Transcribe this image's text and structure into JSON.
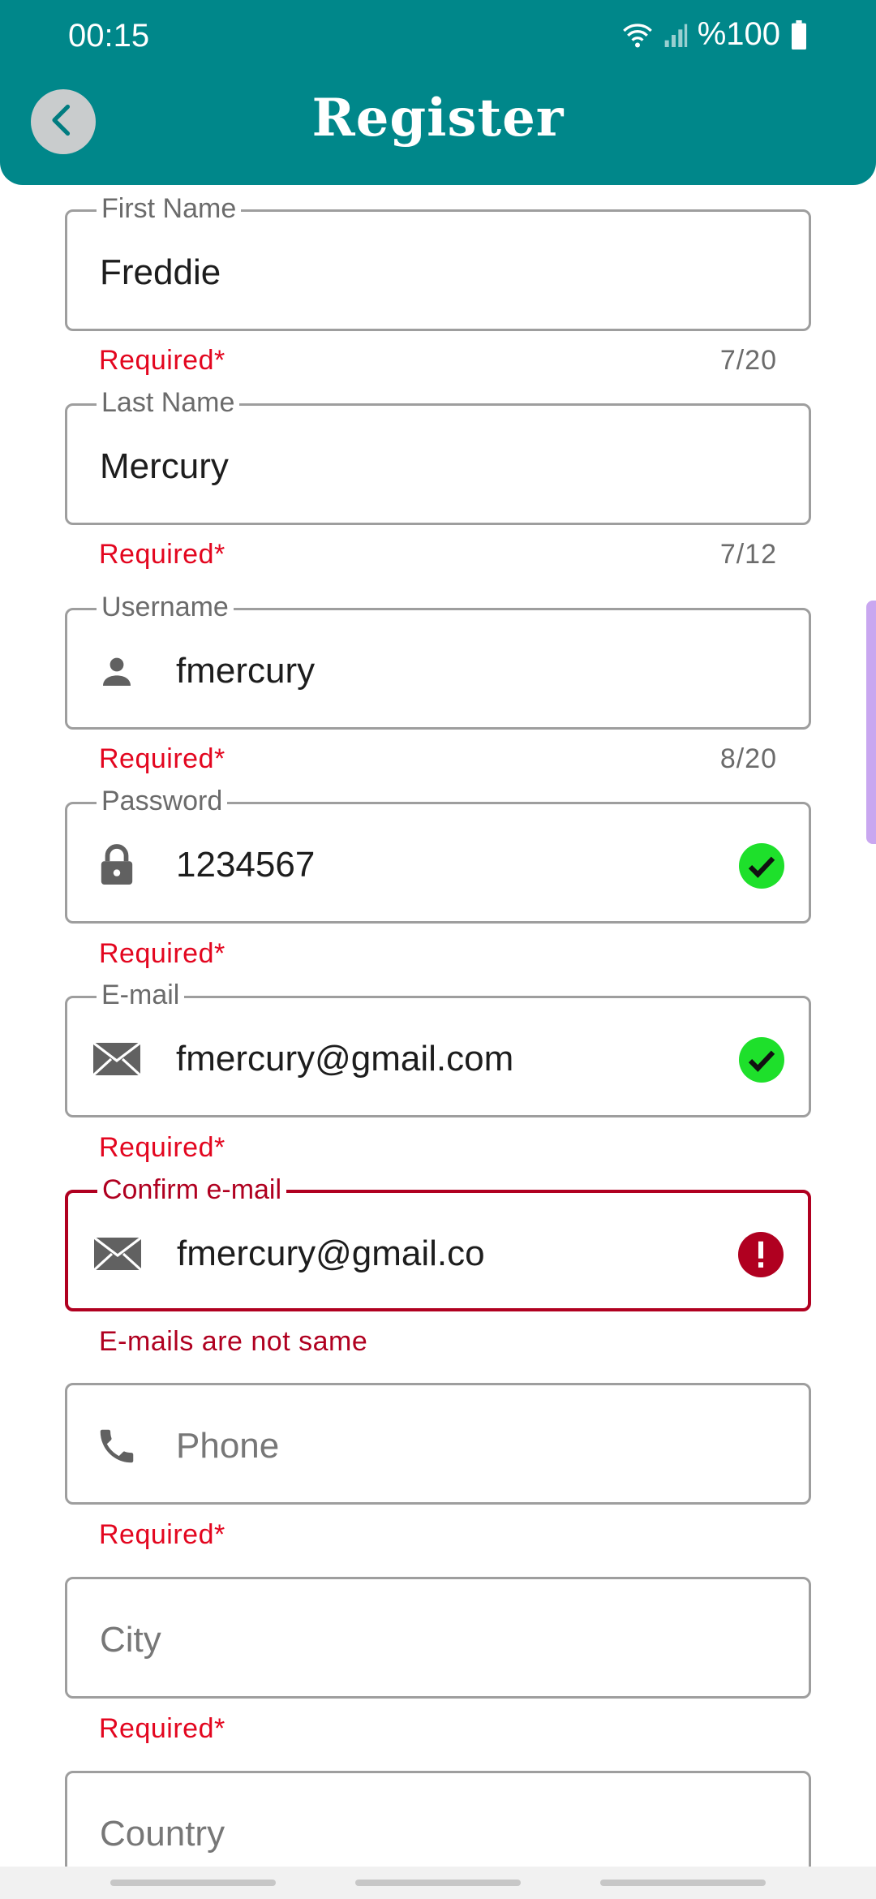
{
  "status_bar": {
    "time": "00:15",
    "battery": "%100"
  },
  "header": {
    "title": "Register"
  },
  "fields": {
    "first_name": {
      "label": "First Name",
      "value": "Freddie",
      "helper": "Required*",
      "counter": "7/20"
    },
    "last_name": {
      "label": "Last Name",
      "value": "Mercury",
      "helper": "Required*",
      "counter": "7/12"
    },
    "username": {
      "label": "Username",
      "value": "fmercury",
      "helper": "Required*",
      "counter": "8/20"
    },
    "password": {
      "label": "Password",
      "value": "1234567",
      "helper": "Required*"
    },
    "email": {
      "label": "E-mail",
      "value": "fmercury@gmail.com",
      "helper": "Required*"
    },
    "confirm_email": {
      "label": "Confirm e-mail",
      "value": "fmercury@gmail.co",
      "error": "E-mails are not same"
    },
    "phone": {
      "placeholder": "Phone",
      "helper": "Required*"
    },
    "city": {
      "placeholder": "City",
      "helper": "Required*"
    },
    "country": {
      "placeholder": "Country"
    }
  },
  "colors": {
    "appbar": "#00878a",
    "error": "#b00020",
    "required": "#e3061f",
    "valid": "#1ee02b"
  },
  "icons": [
    "back-arrow-icon",
    "person-icon",
    "lock-icon",
    "mail-icon",
    "phone-icon",
    "check-circle-icon",
    "error-circle-icon"
  ]
}
